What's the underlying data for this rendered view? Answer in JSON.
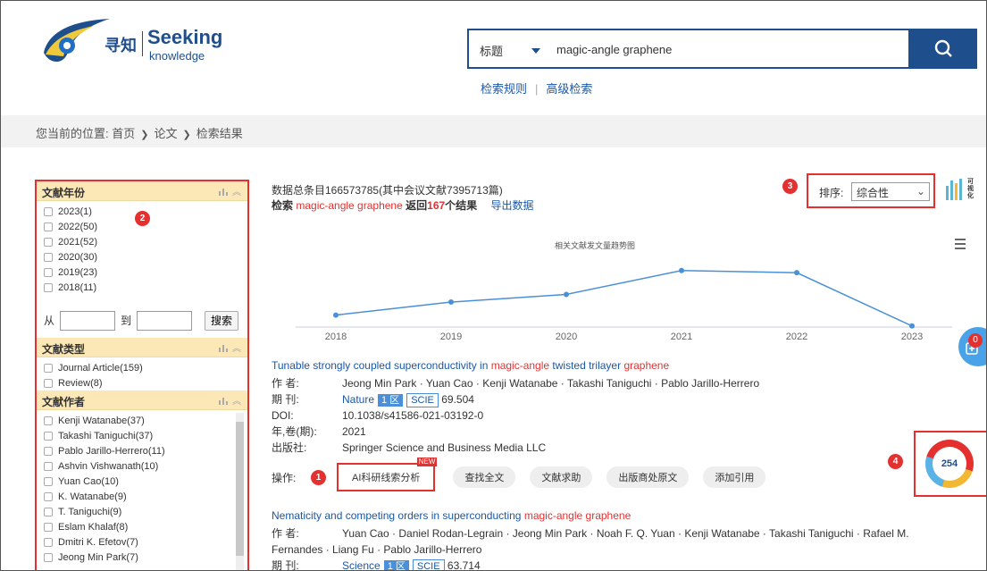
{
  "header": {
    "logo_cn": "寻知",
    "logo_en": "Seeking",
    "logo_sub": "knowledge",
    "search_type": "标题",
    "search_value": "magic-angle graphene",
    "link_rules": "检索规则",
    "link_advanced": "高级检索"
  },
  "breadcrumb": {
    "prefix": "您当前的位置:",
    "home": "首页",
    "papers": "论文",
    "results": "检索结果"
  },
  "filters": {
    "year": {
      "title": "文献年份",
      "items": [
        "2023(1)",
        "2022(50)",
        "2021(52)",
        "2020(30)",
        "2019(23)",
        "2018(11)"
      ],
      "from_label": "从",
      "to_label": "到",
      "search_button": "搜索"
    },
    "type": {
      "title": "文献类型",
      "items": [
        "Journal Article(159)",
        "Review(8)"
      ]
    },
    "author": {
      "title": "文献作者",
      "items": [
        "Kenji Watanabe(37)",
        "Takashi Taniguchi(37)",
        "Pablo Jarillo-Herrero(11)",
        "Ashvin Vishwanath(10)",
        "Yuan Cao(10)",
        "K. Watanabe(9)",
        "T. Taniguchi(9)",
        "Eslam Khalaf(8)",
        "Dmitri K. Efetov(7)",
        "Jeong Min Park(7)"
      ]
    }
  },
  "markers": {
    "m1": "1",
    "m2": "2",
    "m3": "3",
    "m4": "4"
  },
  "summary": {
    "line1": "数据总条目166573785(其中会议文献7395713篇)",
    "search_word": "检索",
    "query": "magic-angle graphene",
    "returned": "返回",
    "count": "167",
    "results_unit": "个结果",
    "export": "导出数据"
  },
  "sort": {
    "label": "排序:",
    "value": "综合性"
  },
  "viz_label": "可视化",
  "fab_count": "0",
  "chart_data": {
    "type": "line",
    "title": "相关文献发文量趋势图",
    "x": [
      "2018",
      "2019",
      "2020",
      "2021",
      "2022",
      "2023"
    ],
    "series": [
      {
        "values": [
          11,
          23,
          30,
          52,
          50,
          1
        ]
      }
    ],
    "ylim": [
      0,
      60
    ],
    "grid": false,
    "color": "#4a90d9"
  },
  "results": [
    {
      "title_pre": "Tunable strongly coupled superconductivity in ",
      "title_hl1": "magic-angle",
      "title_mid": " twisted trilayer ",
      "title_hl2": "graphene",
      "authors_label": "作 者:",
      "authors": "Jeong Min Park · Yuan Cao · Kenji Watanabe · Takashi Taniguchi · Pablo Jarillo-Herrero",
      "journal_label": "期 刊:",
      "journal": "Nature",
      "zone": "1 区",
      "scie": "SCIE",
      "impact": "69.504",
      "doi_label": "DOI:",
      "doi": "10.1038/s41586-021-03192-0",
      "year_label": "年,卷(期):",
      "year": "2021",
      "publisher_label": "出版社:",
      "publisher": "Springer Science and Business Media LLC",
      "ops_label": "操作:",
      "ops": {
        "ai": "AI科研线索分析",
        "new": "NEW",
        "fulltext": "查找全文",
        "help": "文献求助",
        "publisher": "出版商处原文",
        "cite": "添加引用"
      },
      "altmetric": "254"
    },
    {
      "title_pre": "Nematicity and competing orders in superconducting ",
      "title_hl1": "magic-angle graphene",
      "authors_label": "作 者:",
      "authors": "Yuan Cao · Daniel Rodan-Legrain · Jeong Min Park · Noah F. Q. Yuan · Kenji Watanabe · Takashi Taniguchi · Rafael M.",
      "authors2": "Fernandes · Liang Fu · Pablo Jarillo-Herrero",
      "journal_label": "期 刊:",
      "journal": "Science",
      "zone": "1 区",
      "scie": "SCIE",
      "impact": "63.714"
    }
  ]
}
